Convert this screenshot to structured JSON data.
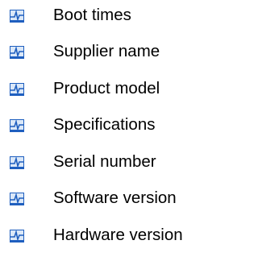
{
  "list": {
    "items": [
      {
        "label": "Boot times",
        "icon": "waveform-icon"
      },
      {
        "label": "Supplier name",
        "icon": "waveform-icon"
      },
      {
        "label": "Product model",
        "icon": "waveform-icon"
      },
      {
        "label": "Specifications",
        "icon": "waveform-icon"
      },
      {
        "label": "Serial number",
        "icon": "waveform-icon"
      },
      {
        "label": "Software version",
        "icon": "waveform-icon"
      },
      {
        "label": "Hardware version",
        "icon": "waveform-icon"
      }
    ]
  },
  "colors": {
    "icon_blue": "#1f5fbf",
    "icon_light": "#dbe8f8",
    "text": "#000000"
  }
}
